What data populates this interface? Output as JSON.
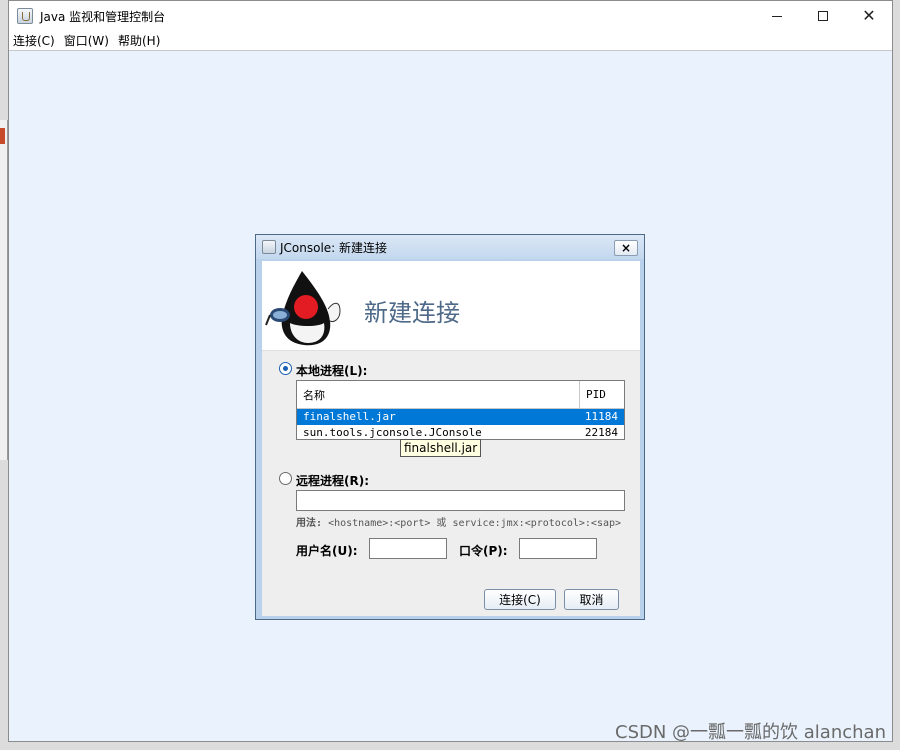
{
  "window": {
    "title": "Java 监视和管理控制台",
    "minimize_glyph": "—",
    "maximize_glyph": "□",
    "close_glyph": "✕"
  },
  "menu": {
    "items": [
      {
        "label": "连接(C)"
      },
      {
        "label": "窗口(W)"
      },
      {
        "label": "帮助(H)"
      }
    ]
  },
  "dialog": {
    "title": "JConsole: 新建连接",
    "close_glyph": "×",
    "banner_title": "新建连接",
    "local": {
      "label": "本地进程(L):",
      "selected": true,
      "columns": [
        "名称",
        "PID"
      ],
      "rows": [
        {
          "name": "finalshell.jar",
          "pid": "11184",
          "selected": true
        },
        {
          "name": "sun.tools.jconsole.JConsole",
          "pid": "22184",
          "selected": false
        }
      ],
      "tooltip": "finalshell.jar"
    },
    "remote": {
      "label": "远程进程(R):",
      "selected": false,
      "host_value": "",
      "usage_label": "用法:",
      "usage_text": "<hostname>:<port> 或 service:jmx:<protocol>:<sap>"
    },
    "username_label": "用户名(U):",
    "username_value": "",
    "password_label": "口令(P):",
    "password_value": "",
    "connect_button": "连接(C)",
    "cancel_button": "取消"
  },
  "watermark": "CSDN @一瓢一瓢的饮 alanchan",
  "colors": {
    "selection": "#0078d7",
    "desktop": "#eaf3fd",
    "banner_title": "#4e6a88"
  }
}
